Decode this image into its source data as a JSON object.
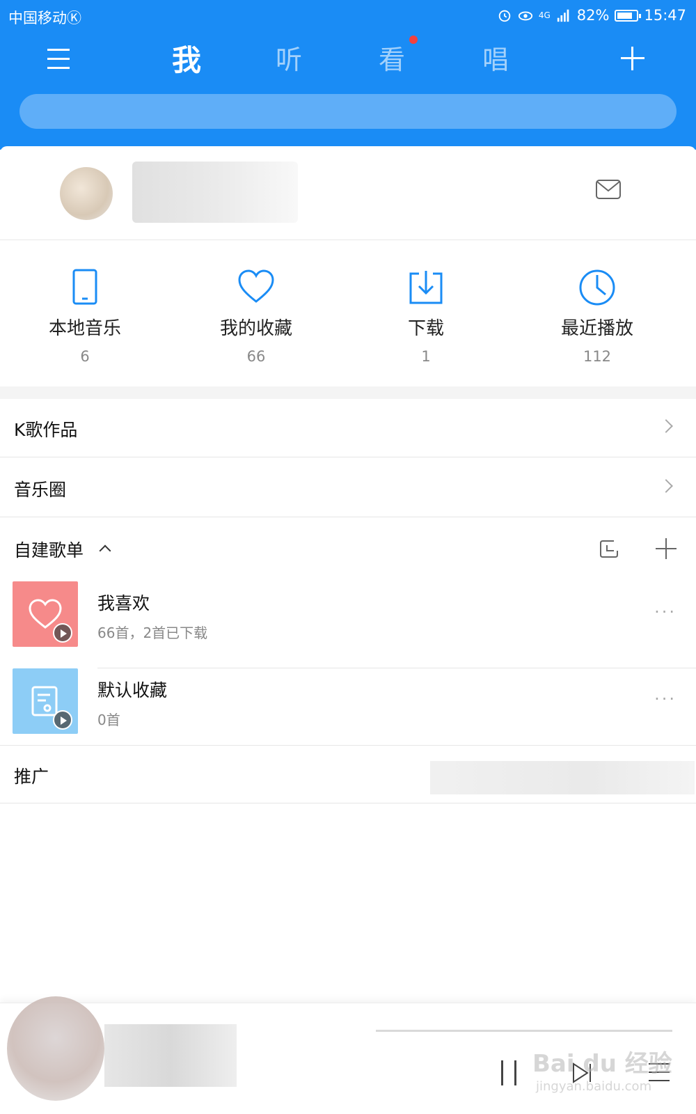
{
  "status_bar": {
    "carrier": "中国移动Ⓚ",
    "signal": "4G",
    "battery": "82%",
    "battery_level": 0.82,
    "time": "15:47"
  },
  "colors": {
    "brand_blue": "#1a8cf5",
    "badge_red": "#f2413f",
    "fav_cover": "#f68a8a",
    "default_cover": "#8dcdf6"
  },
  "tabs": [
    {
      "label": "我",
      "active": true
    },
    {
      "label": "听",
      "active": false
    },
    {
      "label": "看",
      "active": false,
      "has_badge": true
    },
    {
      "label": "唱",
      "active": false
    }
  ],
  "stats": [
    {
      "label": "本地音乐",
      "count": "6",
      "icon": "phone-icon"
    },
    {
      "label": "我的收藏",
      "count": "66",
      "icon": "heart-icon"
    },
    {
      "label": "下载",
      "count": "1",
      "icon": "download-icon"
    },
    {
      "label": "最近播放",
      "count": "112",
      "icon": "clock-icon"
    }
  ],
  "rows": {
    "karaoke": "K歌作品",
    "circle": "音乐圈",
    "promo": "推广"
  },
  "playlists_section": {
    "title": "自建歌单",
    "items": [
      {
        "name": "我喜欢",
        "subtitle": "66首，2首已下载",
        "more": "···"
      },
      {
        "name": "默认收藏",
        "subtitle": "0首",
        "more": "···"
      }
    ]
  },
  "player": {
    "progress": 0.0
  },
  "watermark": {
    "brand": "Bai du 经验",
    "url": "jingyan.baidu.com"
  }
}
